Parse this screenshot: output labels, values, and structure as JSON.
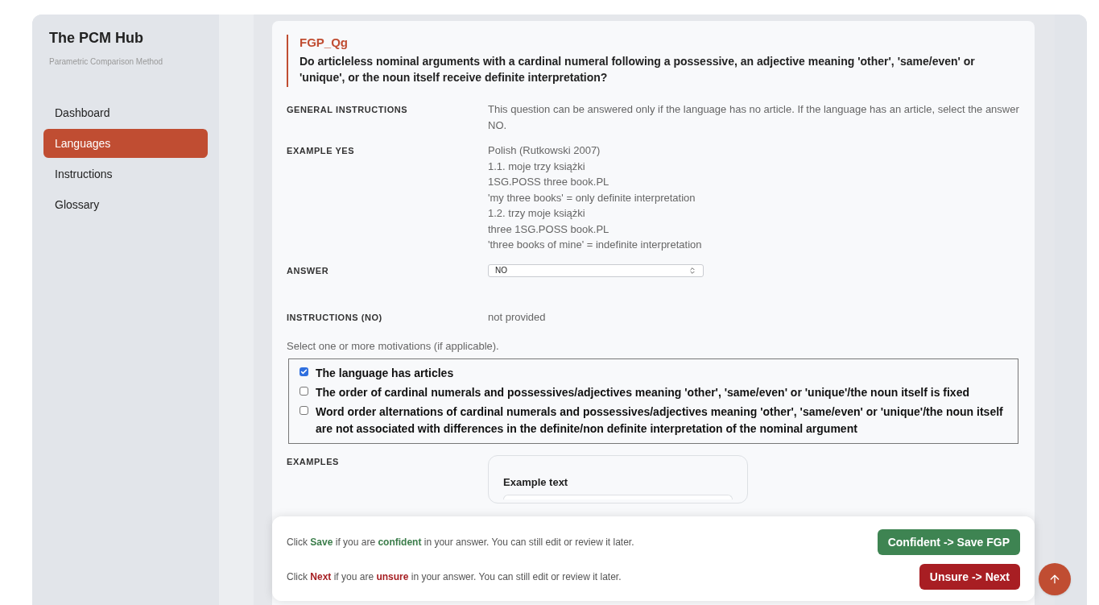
{
  "sidebar": {
    "title": "The PCM Hub",
    "subtitle": "Parametric Comparison Method",
    "items": [
      {
        "label": "Dashboard",
        "selected": false
      },
      {
        "label": "Languages",
        "selected": true
      },
      {
        "label": "Instructions",
        "selected": false
      },
      {
        "label": "Glossary",
        "selected": false
      }
    ]
  },
  "question": {
    "code": "FGP_Qg",
    "text": "Do articleless nominal arguments with a cardinal numeral following a possessive, an adjective meaning 'other', 'same/even' or 'unique', or the noun itself receive definite interpretation?"
  },
  "fields": [
    {
      "kind": "text",
      "label": "GENERAL INSTRUCTIONS",
      "lines": [
        "This question can be answered only if the language has no article. If the language has an article, select the answer NO."
      ]
    },
    {
      "kind": "text",
      "label": "EXAMPLE YES",
      "lines": [
        "Polish (Rutkowski 2007)",
        "1.1. moje trzy książki",
        "1SG.POSS three book.PL",
        "'my three books' = only definite interpretation",
        "1.2. trzy moje książki",
        "three 1SG.POSS book.PL",
        "'three books of mine' = indefinite interpretation"
      ]
    },
    {
      "kind": "select",
      "label": "ANSWER",
      "value": "NO"
    },
    {
      "kind": "text",
      "label": "INSTRUCTIONS (NO)",
      "lines": [
        "not provided"
      ]
    }
  ],
  "motivations": {
    "prompt": "Select one or more motivations (if applicable).",
    "options": [
      {
        "label": "The language has articles",
        "checked": true
      },
      {
        "label": "The order of cardinal numerals and possessives/adjectives meaning 'other', 'same/even' or 'unique'/the noun itself is fixed",
        "checked": false
      },
      {
        "label": "Word order alternations of cardinal numerals and possessives/adjectives meaning 'other', 'same/even' or 'unique'/the noun itself are not associated with differences in the definite/non definite interpretation of the nominal argument",
        "checked": false
      }
    ]
  },
  "examples": {
    "label": "EXAMPLES",
    "card_title": "Example text"
  },
  "action_bar": [
    {
      "kind": "confident",
      "hint": "Click **Save** if you are **confident** in your answer. You can still edit or review it later.",
      "button": "Confident -> Save FGP"
    },
    {
      "kind": "unsure",
      "hint": "Click **Next** if you are **unsure** in your answer. You can still edit or review it later.",
      "button": "Unsure -> Next"
    }
  ]
}
